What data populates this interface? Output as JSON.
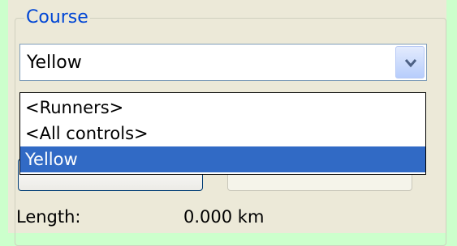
{
  "course_group": {
    "label": "Course",
    "label_color": "#0046d5"
  },
  "course_combo": {
    "selected": "Yellow",
    "icon": "chevron-down-icon",
    "options": [
      {
        "label": "<Runners>"
      },
      {
        "label": "<All controls>"
      },
      {
        "label": "Yellow",
        "selected": true
      }
    ],
    "highlight_color": "#316ac5"
  },
  "length": {
    "label": "Length:",
    "value": "0.000 km"
  },
  "colors": {
    "background": "#ccffcc",
    "panel": "#ece9d8"
  }
}
